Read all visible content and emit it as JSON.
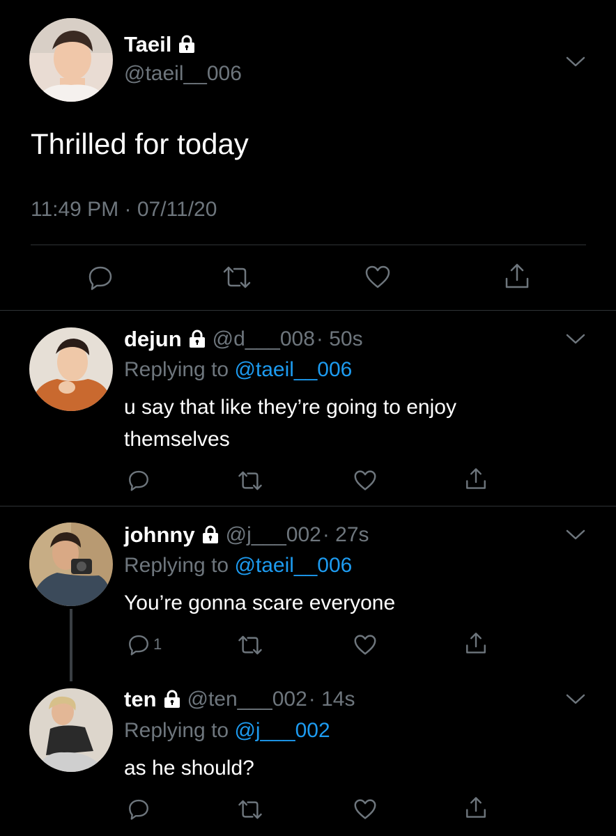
{
  "main_tweet": {
    "display_name": "Taeil",
    "handle": "@taeil__006",
    "text": "Thrilled for today",
    "timestamp": "11:49 PM · 07/11/20",
    "avatar_icon": "avatar-photo",
    "actions": [
      "reply-icon",
      "retweet-icon",
      "like-icon",
      "share-icon"
    ]
  },
  "replies": [
    {
      "display_name": "dejun",
      "handle": "@d___008",
      "age": "· 50s",
      "replying_prefix": "Replying to",
      "replying_to": "@taeil__006",
      "text": "u say that like they’re going to enjoy themselves",
      "reply_count": ""
    },
    {
      "display_name": "johnny",
      "handle": "@j___002",
      "age": "· 27s",
      "replying_prefix": "Replying to",
      "replying_to": "@taeil__006",
      "text": "You’re gonna scare everyone",
      "reply_count": "1"
    },
    {
      "display_name": "ten",
      "handle": "@ten___002",
      "age": "· 14s",
      "replying_prefix": "Replying to",
      "replying_to": "@j___002",
      "text": "as he should?",
      "reply_count": ""
    }
  ],
  "colors": {
    "background": "#000000",
    "text": "#ffffff",
    "muted": "#6e767d",
    "link": "#1d9bf0",
    "divider": "#2f3336"
  }
}
